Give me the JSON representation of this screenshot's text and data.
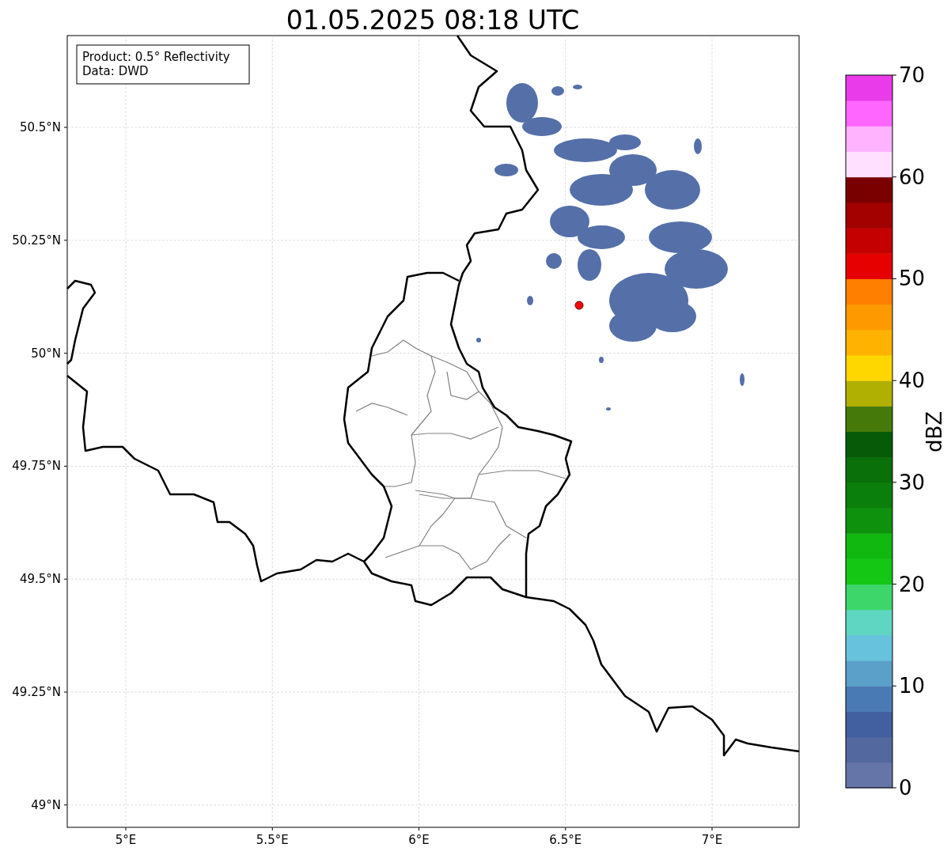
{
  "title": "01.05.2025 08:18 UTC",
  "info_box": {
    "lines": [
      "Product: 0.5° Reflectivity",
      "Data: DWD"
    ]
  },
  "map": {
    "x_ticks": [
      {
        "label": "5°E"
      },
      {
        "label": "5.5°E"
      },
      {
        "label": "6°E"
      },
      {
        "label": "6.5°E"
      },
      {
        "label": "7°E"
      }
    ],
    "y_ticks": [
      {
        "label": "50.5°N"
      },
      {
        "label": "50.25°N"
      },
      {
        "label": "50°N"
      },
      {
        "label": "49.75°N"
      },
      {
        "label": "49.5°N"
      },
      {
        "label": "49.25°N"
      },
      {
        "label": "49°N"
      }
    ]
  },
  "colorbar": {
    "label": "dBZ",
    "ticks": [
      "70",
      "60",
      "50",
      "40",
      "30",
      "20",
      "10",
      "0"
    ],
    "segments": [
      {
        "color": "#6675a8"
      },
      {
        "color": "#5468a0"
      },
      {
        "color": "#4260a0"
      },
      {
        "color": "#4a7ab4"
      },
      {
        "color": "#5aa0c8"
      },
      {
        "color": "#66c2dd"
      },
      {
        "color": "#5fd6c2"
      },
      {
        "color": "#3dd66a"
      },
      {
        "color": "#14c714"
      },
      {
        "color": "#10b810"
      },
      {
        "color": "#0e920e"
      },
      {
        "color": "#0b7f0b"
      },
      {
        "color": "#0a700a"
      },
      {
        "color": "#075a07"
      },
      {
        "color": "#457a0a"
      },
      {
        "color": "#b0b000"
      },
      {
        "color": "#ffd700"
      },
      {
        "color": "#ffb300"
      },
      {
        "color": "#ff9900"
      },
      {
        "color": "#ff7f00"
      },
      {
        "color": "#e60000"
      },
      {
        "color": "#c40000"
      },
      {
        "color": "#a30000"
      },
      {
        "color": "#7a0000"
      },
      {
        "color": "#ffe0ff"
      },
      {
        "color": "#ffb3ff"
      },
      {
        "color": "#ff66ff"
      },
      {
        "color": "#e93be9"
      }
    ]
  }
}
